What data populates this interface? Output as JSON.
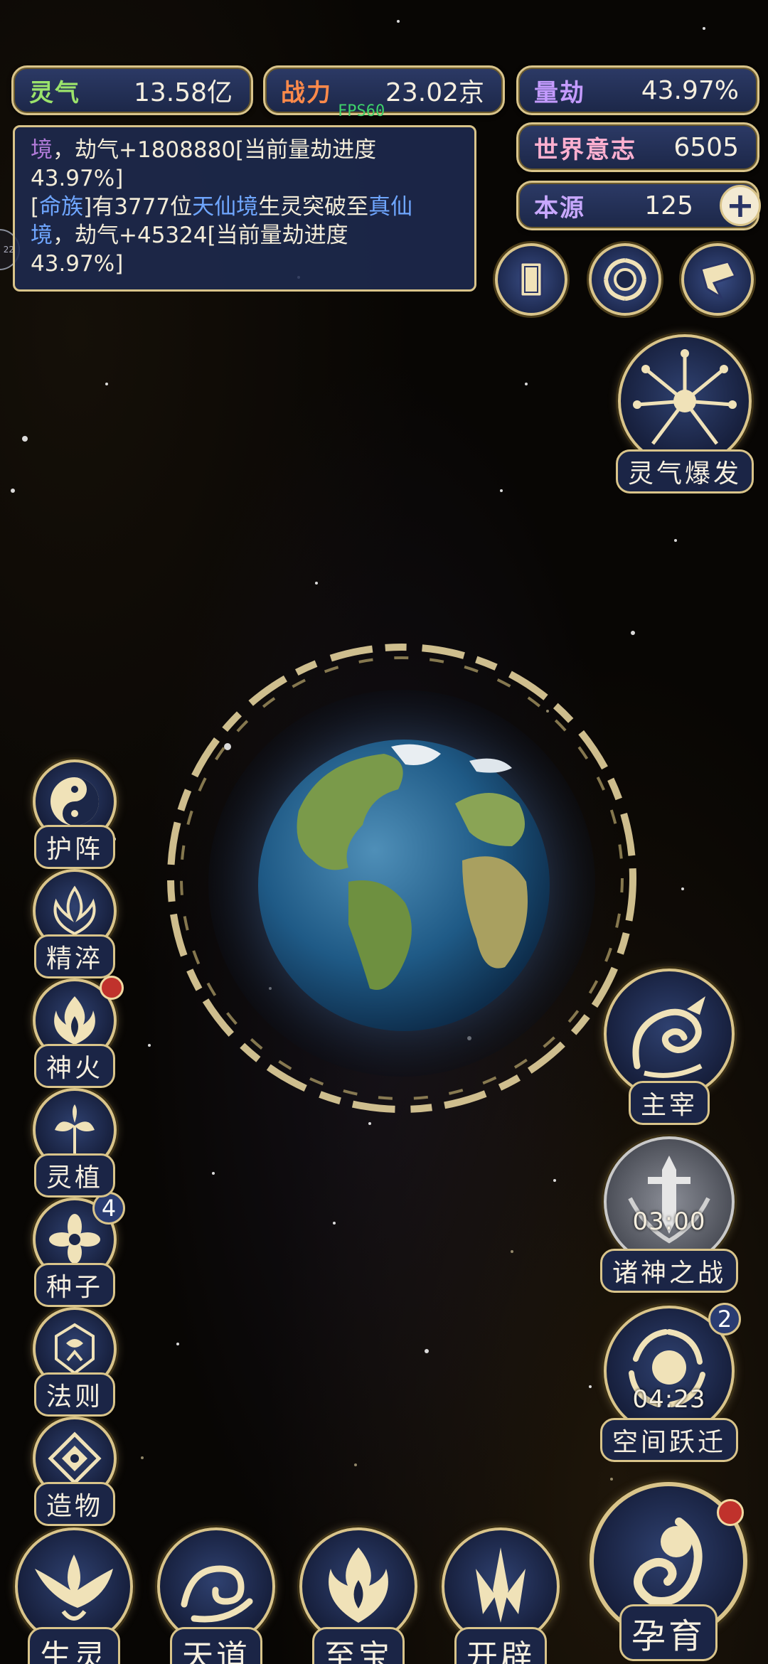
{
  "stats": {
    "lingqi": {
      "label": "灵气",
      "value": "13.58亿"
    },
    "zhanli": {
      "label": "战力",
      "value": "23.02京"
    },
    "liangjie": {
      "label": "量劫",
      "value": "43.97%"
    },
    "shijie": {
      "label": "世界意志",
      "value": "6505"
    },
    "benyuan": {
      "label": "本源",
      "value": "125"
    }
  },
  "fps": "FPS60",
  "log": {
    "line1_a": "境",
    "line1_b": "，劫气+1808880[当前量劫进度",
    "line2": "43.97%]",
    "line3_a": "[",
    "line3_b": "命族",
    "line3_c": "]有3777位",
    "line3_d": "天仙境",
    "line3_e": "生灵突破至",
    "line3_f": "真仙",
    "line4_a": "境",
    "line4_b": "，劫气+45324[当前量劫进度",
    "line5": "43.97%]"
  },
  "left_edge_label": "22",
  "plus_symbol": "+",
  "right_side": {
    "burst": "灵气爆发",
    "zhuzai": "主宰",
    "zhushen": {
      "label": "诸神之战",
      "timer": "03:00"
    },
    "kongjian": {
      "label": "空间跃迁",
      "timer": "04:23",
      "badge": "2"
    }
  },
  "left_side": [
    {
      "label": "护阵",
      "icon": "yin-yang-icon"
    },
    {
      "label": "精淬",
      "icon": "flame-lotus-icon"
    },
    {
      "label": "神火",
      "icon": "fire-icon",
      "red_dot": true
    },
    {
      "label": "灵植",
      "icon": "plant-icon"
    },
    {
      "label": "种子",
      "icon": "seed-flower-icon",
      "badge": "4"
    },
    {
      "label": "法则",
      "icon": "rule-emblem-icon"
    },
    {
      "label": "造物",
      "icon": "creation-diamond-icon"
    }
  ],
  "bottom_nav": [
    {
      "label": "生灵",
      "icon": "phoenix-icon"
    },
    {
      "label": "天道",
      "icon": "wave-cloud-icon"
    },
    {
      "label": "至宝",
      "icon": "treasure-flame-icon"
    },
    {
      "label": "开辟",
      "icon": "axe-split-icon"
    }
  ],
  "yunyu": {
    "label": "孕育",
    "icon": "embryo-icon",
    "red_dot": true
  },
  "colors": {
    "gold": "#d9c48a",
    "panel": "#1c2748",
    "red": "#c0322c"
  }
}
